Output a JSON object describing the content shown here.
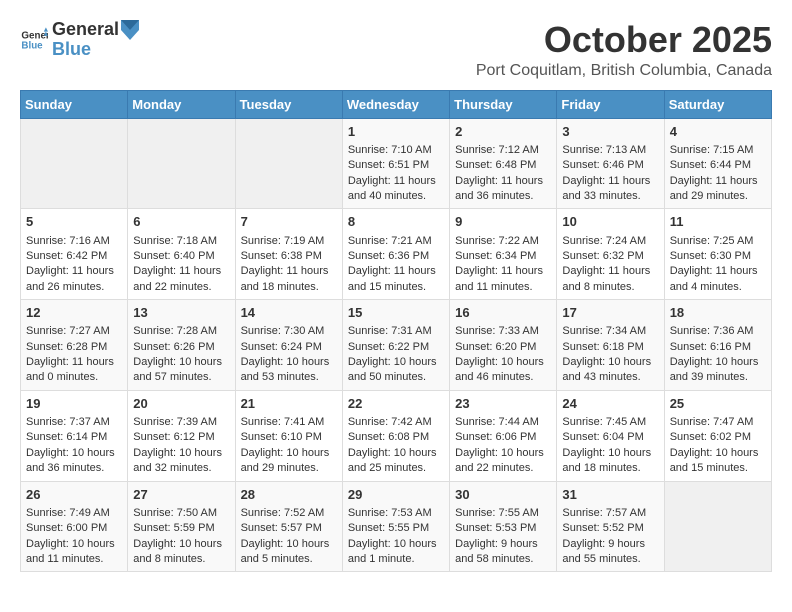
{
  "header": {
    "logo_general": "General",
    "logo_blue": "Blue",
    "title": "October 2025",
    "subtitle": "Port Coquitlam, British Columbia, Canada"
  },
  "days_of_week": [
    "Sunday",
    "Monday",
    "Tuesday",
    "Wednesday",
    "Thursday",
    "Friday",
    "Saturday"
  ],
  "weeks": [
    [
      {
        "day": "",
        "content": ""
      },
      {
        "day": "",
        "content": ""
      },
      {
        "day": "",
        "content": ""
      },
      {
        "day": "1",
        "content": "Sunrise: 7:10 AM\nSunset: 6:51 PM\nDaylight: 11 hours\nand 40 minutes."
      },
      {
        "day": "2",
        "content": "Sunrise: 7:12 AM\nSunset: 6:48 PM\nDaylight: 11 hours\nand 36 minutes."
      },
      {
        "day": "3",
        "content": "Sunrise: 7:13 AM\nSunset: 6:46 PM\nDaylight: 11 hours\nand 33 minutes."
      },
      {
        "day": "4",
        "content": "Sunrise: 7:15 AM\nSunset: 6:44 PM\nDaylight: 11 hours\nand 29 minutes."
      }
    ],
    [
      {
        "day": "5",
        "content": "Sunrise: 7:16 AM\nSunset: 6:42 PM\nDaylight: 11 hours\nand 26 minutes."
      },
      {
        "day": "6",
        "content": "Sunrise: 7:18 AM\nSunset: 6:40 PM\nDaylight: 11 hours\nand 22 minutes."
      },
      {
        "day": "7",
        "content": "Sunrise: 7:19 AM\nSunset: 6:38 PM\nDaylight: 11 hours\nand 18 minutes."
      },
      {
        "day": "8",
        "content": "Sunrise: 7:21 AM\nSunset: 6:36 PM\nDaylight: 11 hours\nand 15 minutes."
      },
      {
        "day": "9",
        "content": "Sunrise: 7:22 AM\nSunset: 6:34 PM\nDaylight: 11 hours\nand 11 minutes."
      },
      {
        "day": "10",
        "content": "Sunrise: 7:24 AM\nSunset: 6:32 PM\nDaylight: 11 hours\nand 8 minutes."
      },
      {
        "day": "11",
        "content": "Sunrise: 7:25 AM\nSunset: 6:30 PM\nDaylight: 11 hours\nand 4 minutes."
      }
    ],
    [
      {
        "day": "12",
        "content": "Sunrise: 7:27 AM\nSunset: 6:28 PM\nDaylight: 11 hours\nand 0 minutes."
      },
      {
        "day": "13",
        "content": "Sunrise: 7:28 AM\nSunset: 6:26 PM\nDaylight: 10 hours\nand 57 minutes."
      },
      {
        "day": "14",
        "content": "Sunrise: 7:30 AM\nSunset: 6:24 PM\nDaylight: 10 hours\nand 53 minutes."
      },
      {
        "day": "15",
        "content": "Sunrise: 7:31 AM\nSunset: 6:22 PM\nDaylight: 10 hours\nand 50 minutes."
      },
      {
        "day": "16",
        "content": "Sunrise: 7:33 AM\nSunset: 6:20 PM\nDaylight: 10 hours\nand 46 minutes."
      },
      {
        "day": "17",
        "content": "Sunrise: 7:34 AM\nSunset: 6:18 PM\nDaylight: 10 hours\nand 43 minutes."
      },
      {
        "day": "18",
        "content": "Sunrise: 7:36 AM\nSunset: 6:16 PM\nDaylight: 10 hours\nand 39 minutes."
      }
    ],
    [
      {
        "day": "19",
        "content": "Sunrise: 7:37 AM\nSunset: 6:14 PM\nDaylight: 10 hours\nand 36 minutes."
      },
      {
        "day": "20",
        "content": "Sunrise: 7:39 AM\nSunset: 6:12 PM\nDaylight: 10 hours\nand 32 minutes."
      },
      {
        "day": "21",
        "content": "Sunrise: 7:41 AM\nSunset: 6:10 PM\nDaylight: 10 hours\nand 29 minutes."
      },
      {
        "day": "22",
        "content": "Sunrise: 7:42 AM\nSunset: 6:08 PM\nDaylight: 10 hours\nand 25 minutes."
      },
      {
        "day": "23",
        "content": "Sunrise: 7:44 AM\nSunset: 6:06 PM\nDaylight: 10 hours\nand 22 minutes."
      },
      {
        "day": "24",
        "content": "Sunrise: 7:45 AM\nSunset: 6:04 PM\nDaylight: 10 hours\nand 18 minutes."
      },
      {
        "day": "25",
        "content": "Sunrise: 7:47 AM\nSunset: 6:02 PM\nDaylight: 10 hours\nand 15 minutes."
      }
    ],
    [
      {
        "day": "26",
        "content": "Sunrise: 7:49 AM\nSunset: 6:00 PM\nDaylight: 10 hours\nand 11 minutes."
      },
      {
        "day": "27",
        "content": "Sunrise: 7:50 AM\nSunset: 5:59 PM\nDaylight: 10 hours\nand 8 minutes."
      },
      {
        "day": "28",
        "content": "Sunrise: 7:52 AM\nSunset: 5:57 PM\nDaylight: 10 hours\nand 5 minutes."
      },
      {
        "day": "29",
        "content": "Sunrise: 7:53 AM\nSunset: 5:55 PM\nDaylight: 10 hours\nand 1 minute."
      },
      {
        "day": "30",
        "content": "Sunrise: 7:55 AM\nSunset: 5:53 PM\nDaylight: 9 hours\nand 58 minutes."
      },
      {
        "day": "31",
        "content": "Sunrise: 7:57 AM\nSunset: 5:52 PM\nDaylight: 9 hours\nand 55 minutes."
      },
      {
        "day": "",
        "content": ""
      }
    ]
  ],
  "accent_color": "#4a90c4"
}
